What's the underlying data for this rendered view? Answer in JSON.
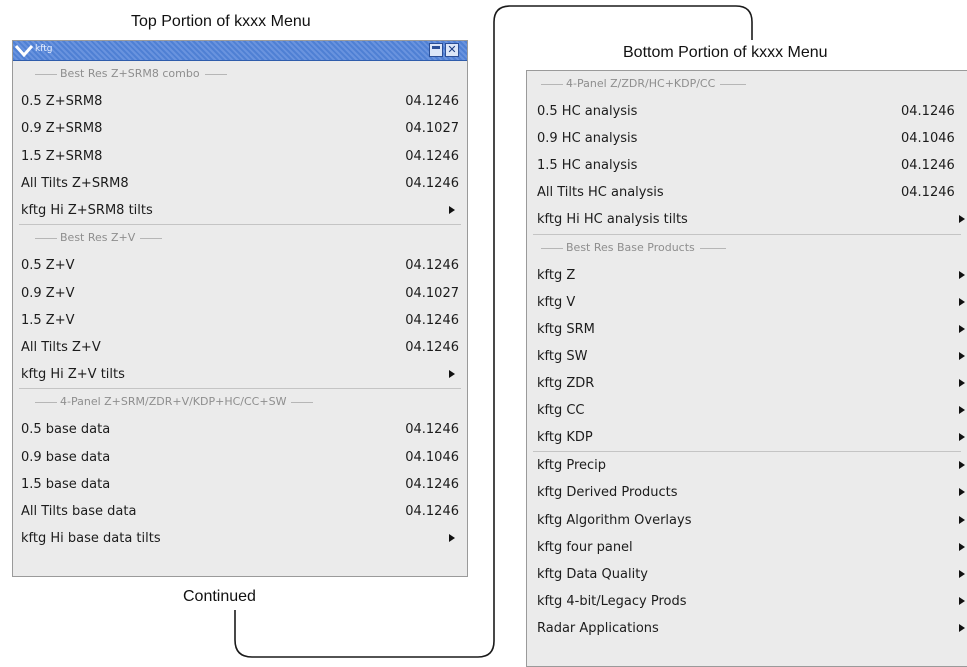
{
  "captions": {
    "top": "Top Portion of kxxx Menu",
    "bottom": "Bottom Portion of kxxx Menu",
    "continued": "Continued"
  },
  "window": {
    "title": "kftg",
    "minimize_icon": "window-icon",
    "close_icon": "close-icon",
    "menu_icon": "chevron-down-icon"
  },
  "top_menu": {
    "sections": [
      {
        "header": "Best Res Z+SRM8 combo",
        "items": [
          {
            "label": "0.5 Z+SRM8",
            "version": "04.1246"
          },
          {
            "label": "0.9 Z+SRM8",
            "version": "04.1027"
          },
          {
            "label": "1.5 Z+SRM8",
            "version": "04.1246"
          },
          {
            "label": "All Tilts Z+SRM8",
            "version": "04.1246"
          },
          {
            "label": "kftg Hi Z+SRM8 tilts",
            "submenu": true
          }
        ]
      },
      {
        "header": "Best Res Z+V",
        "items": [
          {
            "label": "0.5 Z+V",
            "version": "04.1246"
          },
          {
            "label": "0.9 Z+V",
            "version": "04.1027"
          },
          {
            "label": "1.5 Z+V",
            "version": "04.1246"
          },
          {
            "label": "All Tilts Z+V",
            "version": "04.1246"
          },
          {
            "label": "kftg Hi Z+V tilts",
            "submenu": true
          }
        ]
      },
      {
        "header": "4-Panel Z+SRM/ZDR+V/KDP+HC/CC+SW",
        "items": [
          {
            "label": "0.5 base data",
            "version": "04.1246"
          },
          {
            "label": "0.9 base data",
            "version": "04.1046"
          },
          {
            "label": "1.5 base data",
            "version": "04.1246"
          },
          {
            "label": "All Tilts base data",
            "version": "04.1246"
          },
          {
            "label": "kftg Hi base data tilts",
            "submenu": true
          }
        ]
      }
    ]
  },
  "bottom_menu": {
    "sections": [
      {
        "header": "4-Panel Z/ZDR/HC+KDP/CC",
        "items": [
          {
            "label": "0.5 HC analysis",
            "version": "04.1246"
          },
          {
            "label": "0.9 HC analysis",
            "version": "04.1046"
          },
          {
            "label": "1.5 HC analysis",
            "version": "04.1246"
          },
          {
            "label": "All Tilts HC analysis",
            "version": "04.1246"
          },
          {
            "label": "kftg Hi HC analysis tilts",
            "submenu": true
          }
        ]
      },
      {
        "header": "Best Res Base Products",
        "items": [
          {
            "label": "kftg Z",
            "submenu": true
          },
          {
            "label": "kftg V",
            "submenu": true
          },
          {
            "label": "kftg SRM",
            "submenu": true
          },
          {
            "label": "kftg SW",
            "submenu": true
          },
          {
            "label": "kftg ZDR",
            "submenu": true
          },
          {
            "label": "kftg CC",
            "submenu": true
          },
          {
            "label": "kftg KDP",
            "submenu": true
          }
        ]
      },
      {
        "header": "",
        "items": [
          {
            "label": "kftg Precip",
            "submenu": true
          },
          {
            "label": "kftg Derived Products",
            "submenu": true
          },
          {
            "label": "kftg Algorithm Overlays",
            "submenu": true
          },
          {
            "label": "kftg four panel",
            "submenu": true
          },
          {
            "label": "kftg Data Quality",
            "submenu": true
          },
          {
            "label": "kftg 4-bit/Legacy Prods",
            "submenu": true
          },
          {
            "label": "Radar Applications",
            "submenu": true
          }
        ]
      }
    ]
  },
  "colors": {
    "menu_bg": "#ebebeb",
    "titlebar": "#5a88d8",
    "header_text": "#8e8e8e"
  }
}
